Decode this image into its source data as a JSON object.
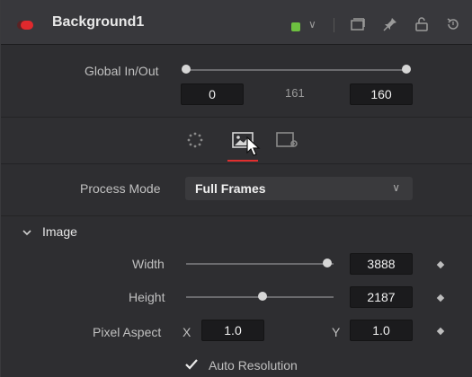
{
  "header": {
    "title": "Background1",
    "color_swatch": "#6dc040",
    "icons": [
      "record-icon",
      "chevron-down-icon",
      "collapse-icon",
      "pin-icon",
      "lock-icon",
      "reset-icon"
    ]
  },
  "global_inout": {
    "label": "Global In/Out",
    "in_value": "0",
    "mid_value": "161",
    "out_value": "160"
  },
  "tabs": [
    "settings-tab",
    "image-tab",
    "display-tab"
  ],
  "process_mode": {
    "label": "Process Mode",
    "value": "Full Frames"
  },
  "image_section": {
    "title": "Image",
    "width": {
      "label": "Width",
      "value": "3888",
      "slider_fraction": 0.99
    },
    "height": {
      "label": "Height",
      "value": "2187",
      "slider_fraction": 0.55
    },
    "pixel_aspect": {
      "label": "Pixel Aspect",
      "x_label": "X",
      "x_value": "1.0",
      "y_label": "Y",
      "y_value": "1.0"
    },
    "auto_resolution": {
      "label": "Auto Resolution",
      "checked": true
    }
  },
  "colors": {
    "accent": "#e02f2f",
    "panel": "#2e2e31",
    "field": "#1b1b1d"
  }
}
